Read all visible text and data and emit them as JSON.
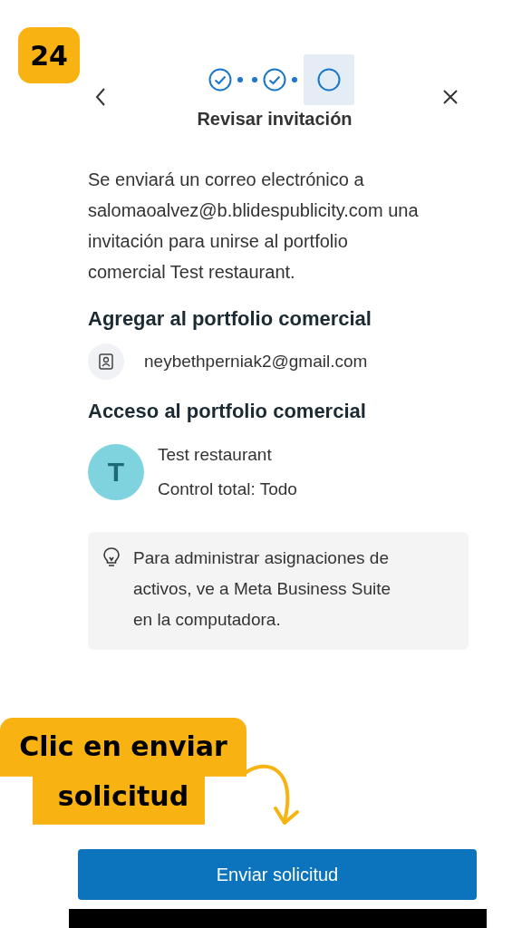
{
  "step_badge": "24",
  "header": {
    "steps": [
      {
        "done": true,
        "selected": false
      },
      {
        "done": true,
        "selected": false
      },
      {
        "done": false,
        "selected": true
      }
    ],
    "title": "Revisar invitación"
  },
  "intro": "Se enviará un correo electrónico a salomaoalvez@b.blidespublicity.com una invitación para unirse al portfolio comercial Test restaurant.",
  "add_section": {
    "heading": "Agregar al portfolio comercial",
    "email": "neybethperniak2@gmail.com"
  },
  "access_section": {
    "heading": "Acceso al portfolio comercial",
    "avatar_letter": "T",
    "name": "Test restaurant",
    "permission": "Control total: Todo"
  },
  "tip": "Para administrar asignaciones de activos, ve a Meta Business Suite en la computadora.",
  "callout": "Clic en enviar solicitud",
  "button": "Enviar solicitud"
}
